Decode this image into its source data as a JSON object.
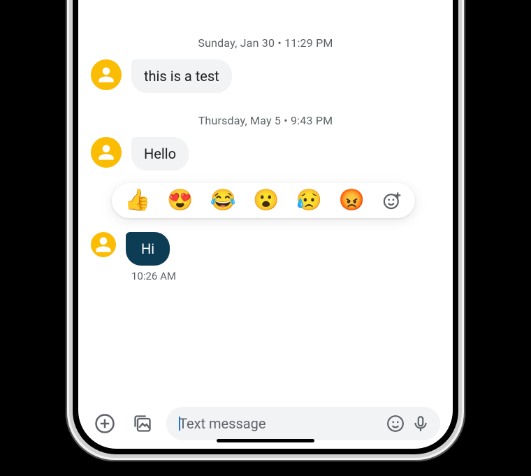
{
  "conversation": {
    "groups": [
      {
        "timestamp": "Sunday, Jan 30 • 11:29 PM",
        "messages": [
          {
            "text": "this is a test",
            "selected": false
          }
        ]
      },
      {
        "timestamp": "Thursday, May 5 • 9:43 PM",
        "messages": [
          {
            "text": "Hello",
            "selected": false
          }
        ]
      },
      {
        "timestamp": null,
        "messages": [
          {
            "text": "Hi",
            "selected": true,
            "sub_timestamp": "10:26 AM"
          }
        ]
      }
    ],
    "reactions": {
      "options": [
        "👍",
        "😍",
        "😂",
        "😮",
        "😥",
        "😡"
      ],
      "more_icon": "emoji-plus-icon"
    }
  },
  "composer": {
    "placeholder": "Text message",
    "value": "",
    "attach_label": "Attach",
    "gallery_label": "Gallery",
    "emoji_label": "Emoji",
    "voice_label": "Voice"
  }
}
